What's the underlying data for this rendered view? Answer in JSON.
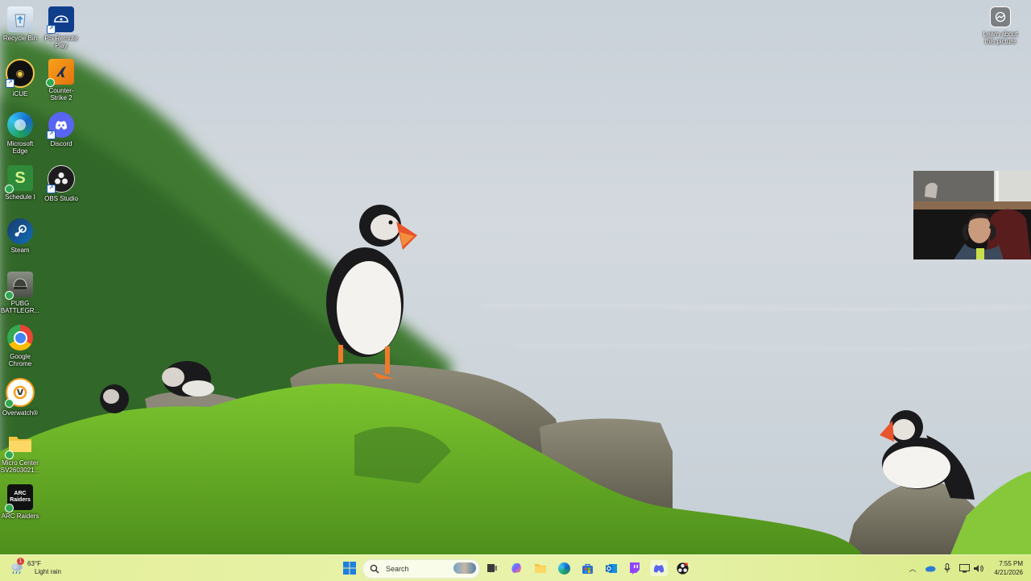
{
  "desktop": {
    "icons": [
      {
        "label": "Recycle Bin",
        "icon": "recycle-bin-icon"
      },
      {
        "label": "PS Remote Play",
        "icon": "ps-remote-play-icon"
      },
      {
        "label": "iCUE",
        "icon": "icue-icon"
      },
      {
        "label": "Counter-Strike 2",
        "icon": "counter-strike-icon"
      },
      {
        "label": "Microsoft Edge",
        "icon": "edge-icon"
      },
      {
        "label": "Discord",
        "icon": "discord-icon"
      },
      {
        "label": "Schedule I",
        "icon": "schedule-icon"
      },
      {
        "label": "OBS Studio",
        "icon": "obs-icon"
      },
      {
        "label": "Steam",
        "icon": "steam-icon"
      },
      {
        "label": "PUBG BATTLEGR...",
        "icon": "pubg-icon"
      },
      {
        "label": "Google Chrome",
        "icon": "chrome-icon"
      },
      {
        "label": "Overwatch®",
        "icon": "overwatch-icon"
      },
      {
        "label": "Micro Center SV2603021...",
        "icon": "folder-icon"
      },
      {
        "label": "ARC Raiders",
        "icon": "arc-raiders-icon"
      }
    ],
    "learn_about": {
      "label": "Learn about this picture",
      "icon": "camera-info-icon"
    }
  },
  "taskbar": {
    "weather": {
      "temp": "63°F",
      "condition": "Light rain",
      "badge": "1",
      "icon": "rain-cloud-icon"
    },
    "search": {
      "placeholder": "Search"
    },
    "pinned": [
      {
        "name": "start",
        "icon": "windows-start-icon"
      },
      {
        "name": "task-view",
        "icon": "task-view-icon"
      },
      {
        "name": "copilot",
        "icon": "copilot-icon"
      },
      {
        "name": "file-explorer",
        "icon": "folder-icon"
      },
      {
        "name": "edge",
        "icon": "edge-icon"
      },
      {
        "name": "store",
        "icon": "store-icon"
      },
      {
        "name": "outlook",
        "icon": "outlook-icon"
      },
      {
        "name": "twitch",
        "icon": "twitch-icon"
      },
      {
        "name": "discord",
        "icon": "discord-icon"
      },
      {
        "name": "obs",
        "icon": "obs-icon"
      }
    ],
    "clock": {
      "time": "7:55 PM",
      "date": "4/21/2026"
    }
  }
}
